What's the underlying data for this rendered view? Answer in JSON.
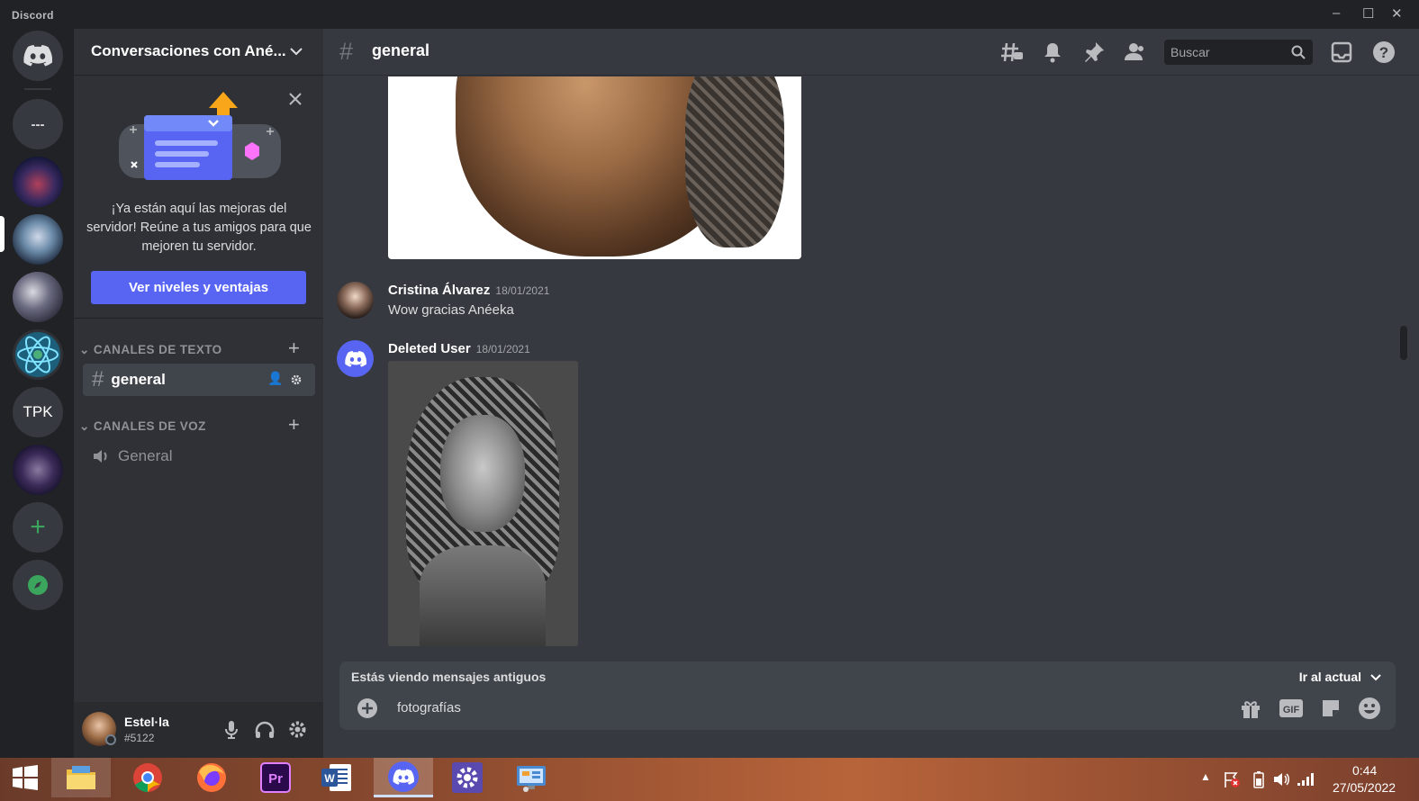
{
  "window": {
    "brand": "Discord",
    "controls": {
      "minimize": "–",
      "maximize": "☐",
      "close": "✕"
    }
  },
  "guilds": {
    "dm_label": "---",
    "tpk_label": "TPK"
  },
  "server": {
    "name": "Conversaciones con Ané..."
  },
  "promo": {
    "text": "¡Ya están aquí las mejoras del servidor! Reúne a tus amigos para que mejoren tu servidor.",
    "button": "Ver niveles y ventajas"
  },
  "categories": [
    {
      "label": "CANALES DE TEXTO",
      "channels": [
        {
          "name": "general",
          "selected": true
        }
      ]
    },
    {
      "label": "CANALES DE VOZ",
      "channels": [
        {
          "name": "General",
          "selected": false
        }
      ]
    }
  ],
  "user": {
    "name": "Estel·la",
    "tag": "#5122"
  },
  "channel": {
    "name": "general",
    "hash": "#"
  },
  "search": {
    "placeholder": "Buscar"
  },
  "messages": [
    {
      "author": "Cristina Álvarez",
      "timestamp": "18/01/2021",
      "text": "Wow gracias Anéeka"
    },
    {
      "author": "Deleted User",
      "timestamp": "18/01/2021",
      "text": ""
    }
  ],
  "old_messages_bar": {
    "text": "Estás viendo mensajes antiguos",
    "jump": "Ir al actual"
  },
  "composer": {
    "value": "fotografías"
  },
  "taskbar": {
    "time": "0:44",
    "date": "27/05/2022"
  },
  "colors": {
    "blurple": "#5865f2",
    "green": "#3ba55d",
    "bg_main": "#36393f",
    "bg_channels": "#2f3136",
    "bg_guilds": "#202225"
  }
}
